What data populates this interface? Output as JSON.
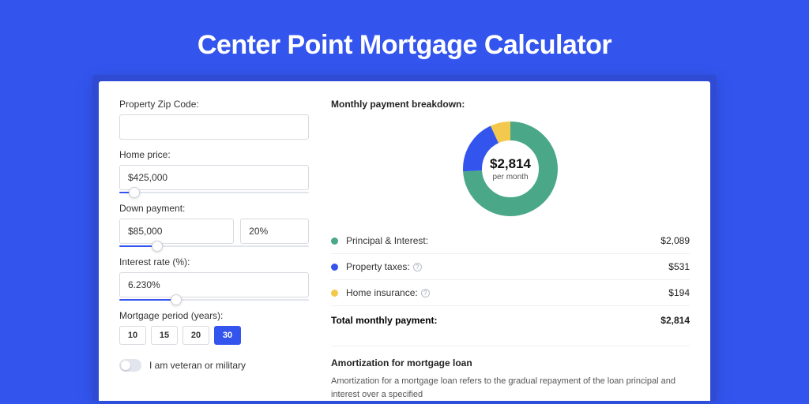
{
  "hero": {
    "title": "Center Point Mortgage Calculator"
  },
  "form": {
    "zip": {
      "label": "Property Zip Code:",
      "value": ""
    },
    "home_price": {
      "label": "Home price:",
      "value": "$425,000",
      "slider_pct": 8
    },
    "down_payment": {
      "label": "Down payment:",
      "amount": "$85,000",
      "pct": "20%",
      "slider_pct": 20
    },
    "interest": {
      "label": "Interest rate (%):",
      "value": "6.230%",
      "slider_pct": 30
    },
    "period": {
      "label": "Mortgage period (years):",
      "options": [
        "10",
        "15",
        "20",
        "30"
      ],
      "active": "30"
    },
    "veteran": {
      "label": "I am veteran or military",
      "on": false
    }
  },
  "breakdown": {
    "title": "Monthly payment breakdown:",
    "center_amount": "$2,814",
    "center_sub": "per month",
    "items": [
      {
        "label": "Principal & Interest:",
        "value": "$2,089",
        "color": "#4aa888",
        "info": false,
        "pct": 74
      },
      {
        "label": "Property taxes:",
        "value": "$531",
        "color": "#3355ee",
        "info": true,
        "pct": 19
      },
      {
        "label": "Home insurance:",
        "value": "$194",
        "color": "#f2c94c",
        "info": true,
        "pct": 7
      }
    ],
    "total_label": "Total monthly payment:",
    "total_value": "$2,814"
  },
  "amort": {
    "title": "Amortization for mortgage loan",
    "text": "Amortization for a mortgage loan refers to the gradual repayment of the loan principal and interest over a specified"
  },
  "chart_data": {
    "type": "pie",
    "title": "Monthly payment breakdown",
    "series": [
      {
        "name": "Principal & Interest",
        "value": 2089,
        "color": "#4aa888"
      },
      {
        "name": "Property taxes",
        "value": 531,
        "color": "#3355ee"
      },
      {
        "name": "Home insurance",
        "value": 194,
        "color": "#f2c94c"
      }
    ],
    "total": 2814,
    "center_label": "$2,814 per month"
  }
}
